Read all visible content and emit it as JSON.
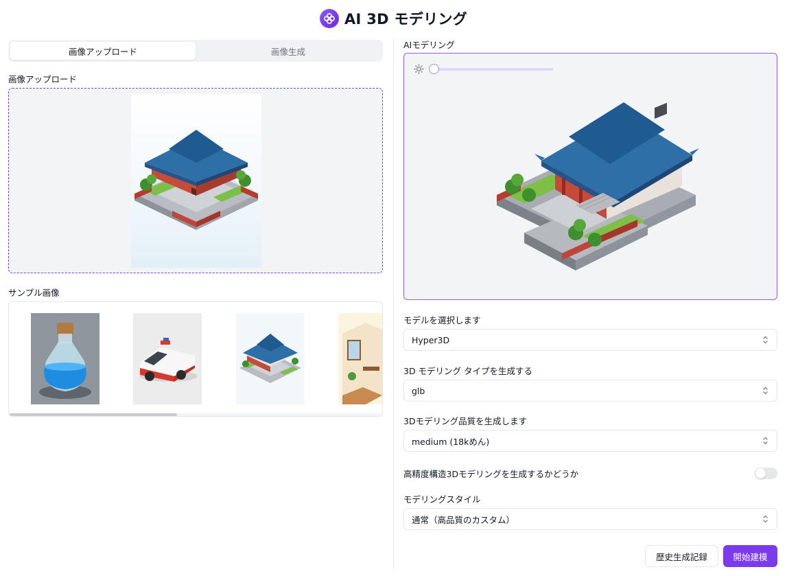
{
  "header": {
    "title": "AI 3D モデリング",
    "logo_icon": "clover-logo-icon",
    "accent": "#7c3aed"
  },
  "left": {
    "tabs": [
      {
        "label": "画像アップロード",
        "active": true
      },
      {
        "label": "画像生成",
        "active": false
      }
    ],
    "upload_label": "画像アップロード",
    "samples_label": "サンプル画像",
    "samples": [
      {
        "icon": "potion-bottle-image"
      },
      {
        "icon": "ambulance-image"
      },
      {
        "icon": "chinese-house-image"
      },
      {
        "icon": "room-image"
      }
    ]
  },
  "right": {
    "viewer_label": "AIモデリング",
    "brightness_icon": "sun-icon",
    "fields": [
      {
        "label": "モデルを選択します",
        "value": "Hyper3D"
      },
      {
        "label": "3D モデリング タイプを生成する",
        "value": "glb"
      },
      {
        "label": "3Dモデリング品質を生成します",
        "value": "medium (18kめん)"
      }
    ],
    "toggle": {
      "label": "高精度構造3Dモデリングを生成するかどうか",
      "on": false
    },
    "style": {
      "label": "モデリングスタイル",
      "value": "通常（高品質のカスタム）"
    },
    "buttons": {
      "history": "歴史生成記録",
      "start": "開始建模"
    }
  }
}
